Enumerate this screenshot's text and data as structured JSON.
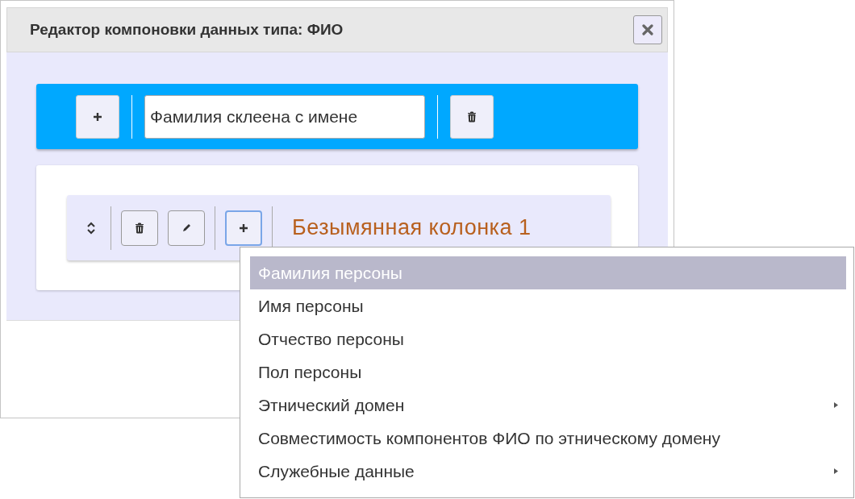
{
  "dialog": {
    "title": "Редактор компоновки данных типа: ФИО"
  },
  "layout_bar": {
    "name_value": "Фамилия склеена с имене"
  },
  "column": {
    "title": "Безымянная колонка 1",
    "add_focused": true
  },
  "menu": {
    "items": [
      {
        "label": "Фамилия персоны",
        "selected": true,
        "submenu": false
      },
      {
        "label": "Имя персоны",
        "selected": false,
        "submenu": false
      },
      {
        "label": "Отчество персоны",
        "selected": false,
        "submenu": false
      },
      {
        "label": "Пол персоны",
        "selected": false,
        "submenu": false
      },
      {
        "label": "Этнический домен",
        "selected": false,
        "submenu": true
      },
      {
        "label": "Совместимость компонентов ФИО по этническому домену",
        "selected": false,
        "submenu": false
      },
      {
        "label": "Служебные данные",
        "selected": false,
        "submenu": true
      }
    ]
  }
}
